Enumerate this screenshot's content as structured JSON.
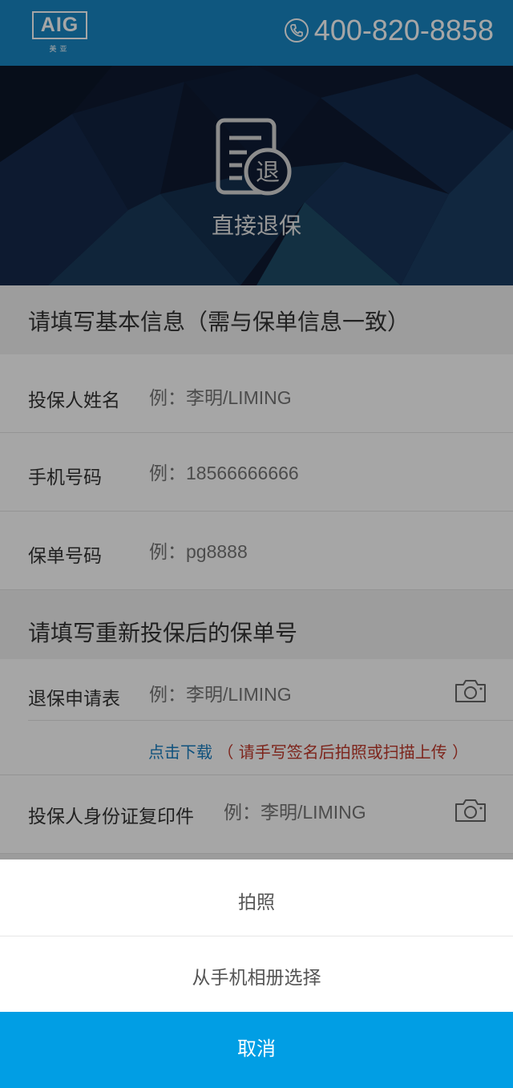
{
  "header": {
    "logo_text": "AIG",
    "logo_sub": "美亚",
    "phone_number": "400-820-8858"
  },
  "hero": {
    "icon_char": "退",
    "title": "直接退保"
  },
  "section1": {
    "title": "请填写基本信息（需与保单信息一致）",
    "fields": [
      {
        "label": "投保人姓名",
        "placeholder": "例：李明/LIMING"
      },
      {
        "label": "手机号码",
        "placeholder": "例：18566666666"
      },
      {
        "label": "保单号码",
        "placeholder": "例：pg8888"
      }
    ]
  },
  "section2": {
    "title": "请填写重新投保后的保单号",
    "refund_form": {
      "label": "退保申请表",
      "placeholder": "例：李明/LIMING"
    },
    "download_link": "点击下载",
    "download_note": "（ 请手写签名后拍照或扫描上传 ）",
    "id_copy": {
      "label": "投保人身份证复印件",
      "placeholder": "例：李明/LIMING"
    }
  },
  "action_sheet": {
    "take_photo": "拍照",
    "choose_album": "从手机相册选择",
    "cancel": "取消"
  },
  "colors": {
    "header_bg": "#1786c4",
    "cancel_bg": "#019ee4",
    "link": "#1a7fc1",
    "note": "#c0392b"
  }
}
